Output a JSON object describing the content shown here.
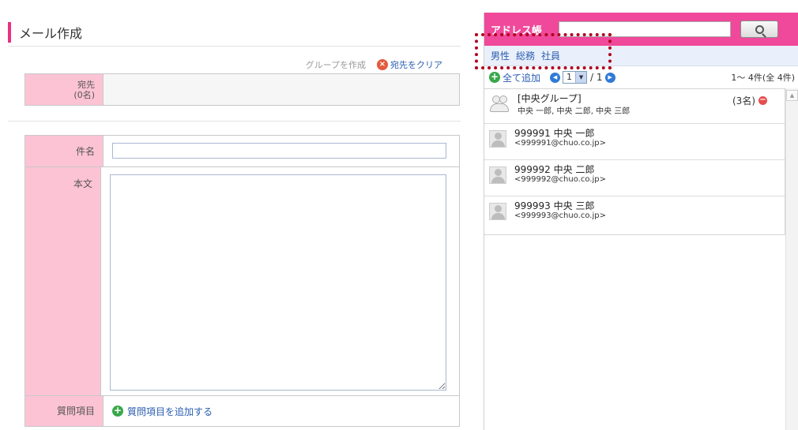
{
  "compose": {
    "title": "メール作成",
    "create_group": "グループを作成",
    "clear_recipients": "宛先をクリア",
    "to_label": "宛先",
    "to_count": "(0名)",
    "subject_label": "件名",
    "subject_value": "",
    "body_label": "本文",
    "body_value": "",
    "question_label": "質問項目",
    "add_question": "質問項目を追加する"
  },
  "addressbook": {
    "title": "アドレス帳",
    "search_value": "",
    "tags": [
      "男性",
      "総務",
      "社員"
    ],
    "add_all": "全て追加",
    "page_current": "1",
    "page_total": "/ 1",
    "count_text": "1～ 4件(全 4件)",
    "items": [
      {
        "type": "group",
        "name": "[中央グループ]",
        "members": "中央 一郎, 中央 二郎, 中央 三郎",
        "count": "(3名)"
      },
      {
        "type": "person",
        "name": "999991 中央 一郎",
        "email": "<999991@chuo.co.jp>"
      },
      {
        "type": "person",
        "name": "999992 中央 二郎",
        "email": "<999992@chuo.co.jp>"
      },
      {
        "type": "person",
        "name": "999993 中央 三郎",
        "email": "<999993@chuo.co.jp>"
      }
    ]
  },
  "colors": {
    "accent": "#e8327f",
    "label_bg": "#fcc3d5",
    "header_bg": "#f0489a",
    "link": "#2a5db0"
  }
}
